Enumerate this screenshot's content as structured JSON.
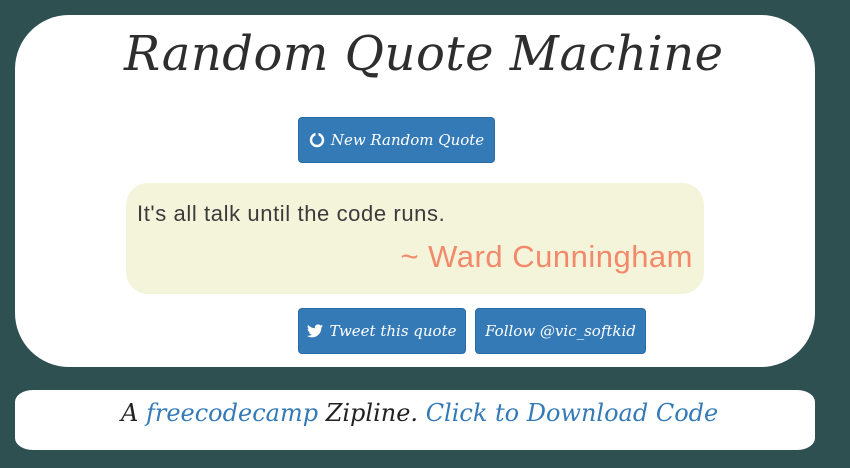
{
  "header": {
    "title": "Random Quote Machine"
  },
  "buttons": {
    "new_quote": {
      "label": "New Random Quote",
      "icon": "circle-refresh-icon"
    },
    "tweet": {
      "label": "Tweet this quote",
      "icon": "twitter-bird-icon"
    },
    "follow": {
      "label": "Follow @vic_softkid"
    }
  },
  "quote": {
    "text": "It's all talk until the code runs.",
    "author": "~ Ward Cunningham"
  },
  "footer": {
    "prefix": "A ",
    "freecodecamp_link": "freecodecamp",
    "middle": " Zipline. ",
    "download_link": "Click to Download Code"
  },
  "colors": {
    "background": "#2f5050",
    "card": "#ffffff",
    "button": "#337ab7",
    "quote_box": "#f4f4db",
    "author": "#f2896a",
    "link": "#337ab7"
  }
}
